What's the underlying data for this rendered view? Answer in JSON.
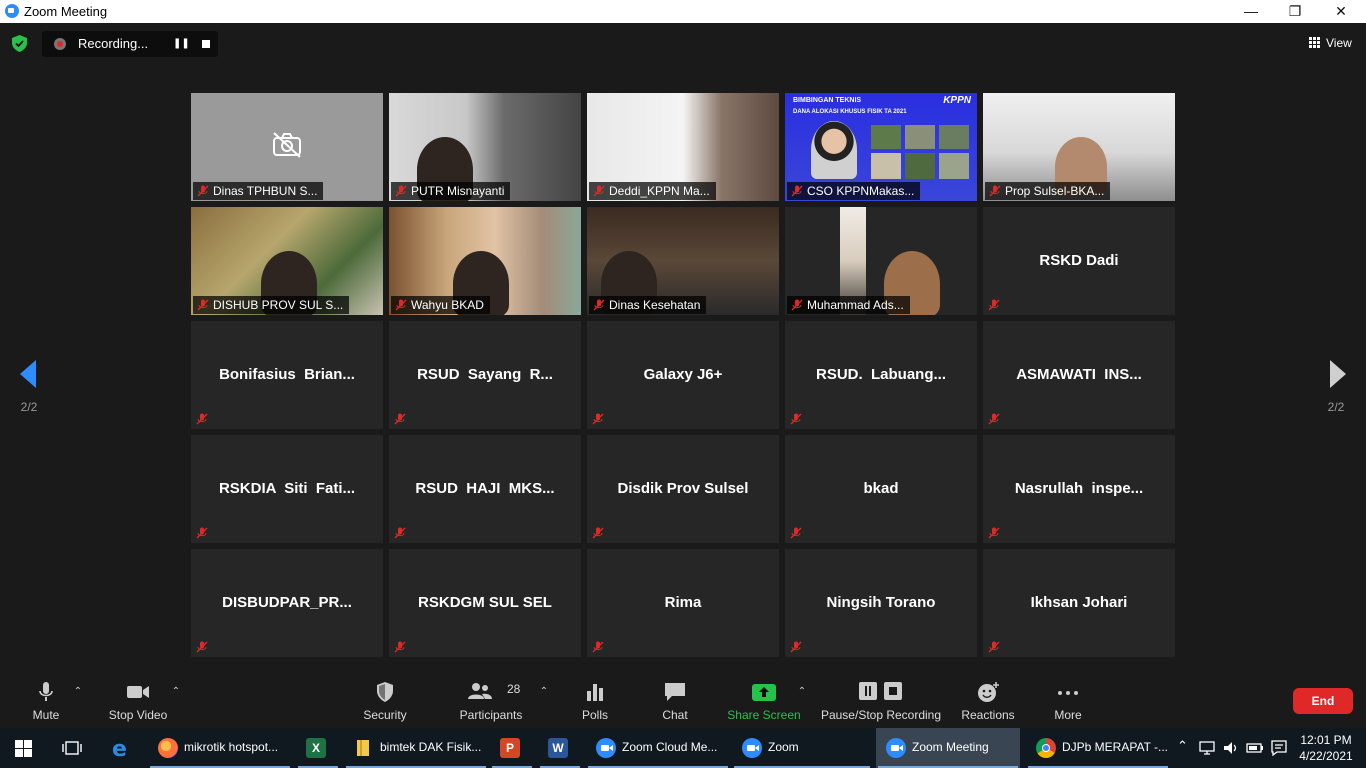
{
  "window": {
    "title": "Zoom Meeting",
    "minimize": "—",
    "maximize": "❐",
    "close": "✕"
  },
  "recording": {
    "label": "Recording...",
    "pause": "❚❚"
  },
  "view": {
    "label": "View"
  },
  "pagination": {
    "left": "2/2",
    "right": "2/2"
  },
  "tiles": [
    {
      "name": "Dinas TPHBUN S...",
      "type": "camoff"
    },
    {
      "name": "PUTR Misnayanti",
      "type": "video"
    },
    {
      "name": "Deddi_KPPN Ma...",
      "type": "video"
    },
    {
      "name": "CSO KPPNMakas...",
      "type": "slide",
      "slide_title": "BIMBINGAN TEKNIS",
      "slide_sub": "DANA ALOKASI KHUSUS FISIK TA 2021",
      "slide_brand": "KPPN"
    },
    {
      "name": "Prop Sulsel-BKA...",
      "type": "video"
    },
    {
      "name": "DISHUB PROV SUL S...",
      "type": "video"
    },
    {
      "name": "Wahyu BKAD",
      "type": "video"
    },
    {
      "name": "Dinas Kesehatan",
      "type": "video"
    },
    {
      "name": "Muhammad Ads...",
      "type": "video"
    },
    {
      "name": "RSKD Dadi",
      "type": "text"
    },
    {
      "name": "Bonifasius  Brian...",
      "type": "text"
    },
    {
      "name": "RSUD  Sayang  R...",
      "type": "text"
    },
    {
      "name": "Galaxy J6+",
      "type": "text"
    },
    {
      "name": "RSUD.  Labuang...",
      "type": "text"
    },
    {
      "name": "ASMAWATI  INS...",
      "type": "text"
    },
    {
      "name": "RSKDIA  Siti  Fati...",
      "type": "text"
    },
    {
      "name": "RSUD  HAJI  MKS...",
      "type": "text"
    },
    {
      "name": "Disdik Prov Sulsel",
      "type": "text"
    },
    {
      "name": "bkad",
      "type": "text"
    },
    {
      "name": "Nasrullah  inspe...",
      "type": "text"
    },
    {
      "name": "DISBUDPAR_PR...",
      "type": "text"
    },
    {
      "name": "RSKDGM SUL SEL",
      "type": "text"
    },
    {
      "name": "Rima",
      "type": "text"
    },
    {
      "name": "Ningsih Torano",
      "type": "text"
    },
    {
      "name": "Ikhsan Johari",
      "type": "text"
    }
  ],
  "toolbar": {
    "mute": "Mute",
    "stop_video": "Stop Video",
    "security": "Security",
    "participants": "Participants",
    "participants_count": "28",
    "polls": "Polls",
    "chat": "Chat",
    "share_screen": "Share Screen",
    "pause_stop_recording": "Pause/Stop Recording",
    "reactions": "Reactions",
    "more": "More",
    "end": "End"
  },
  "taskbar": {
    "items": [
      {
        "label": "mikrotik hotspot...",
        "icon": "firefox-icon"
      },
      {
        "label": "",
        "icon": "excel-icon"
      },
      {
        "label": "bimtek DAK Fisik...",
        "icon": "folder-icon"
      },
      {
        "label": "",
        "icon": "powerpoint-icon"
      },
      {
        "label": "",
        "icon": "word-icon"
      },
      {
        "label": "Zoom Cloud Me...",
        "icon": "zoom-icon"
      },
      {
        "label": "Zoom",
        "icon": "zoom-icon"
      },
      {
        "label": "Zoom Meeting",
        "icon": "zoom-icon"
      },
      {
        "label": "DJPb MERAPAT -...",
        "icon": "chrome-icon"
      }
    ],
    "time": "12:01 PM",
    "date": "4/22/2021"
  },
  "colors": {
    "accent": "#2d8cff",
    "share_green": "#27c24c",
    "end_red": "#e02828",
    "mute_red": "#e02828"
  }
}
